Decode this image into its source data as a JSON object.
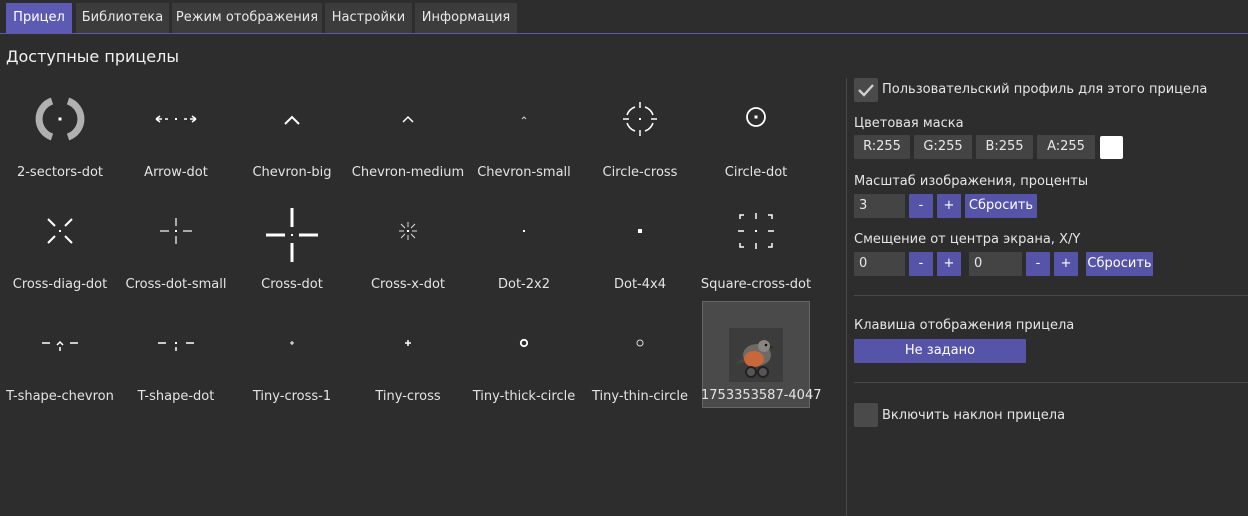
{
  "tabs": [
    {
      "label": "Прицел",
      "active": true
    },
    {
      "label": "Библиотека",
      "active": false
    },
    {
      "label": "Режим отображения",
      "active": false
    },
    {
      "label": "Настройки",
      "active": false
    },
    {
      "label": "Информация",
      "active": false
    }
  ],
  "page_title": "Доступные прицелы",
  "crosshairs": [
    {
      "name": "2-sectors-dot",
      "icon": "two-sectors-dot-icon"
    },
    {
      "name": "Arrow-dot",
      "icon": "arrow-dot-icon"
    },
    {
      "name": "Chevron-big",
      "icon": "chevron-big-icon"
    },
    {
      "name": "Chevron-medium",
      "icon": "chevron-medium-icon"
    },
    {
      "name": "Chevron-small",
      "icon": "chevron-small-icon"
    },
    {
      "name": "Circle-cross",
      "icon": "circle-cross-icon"
    },
    {
      "name": "Circle-dot",
      "icon": "circle-dot-icon"
    },
    {
      "name": "Cross-diag-dot",
      "icon": "cross-diag-dot-icon"
    },
    {
      "name": "Cross-dot-small",
      "icon": "cross-dot-small-icon"
    },
    {
      "name": "Cross-dot",
      "icon": "cross-dot-icon"
    },
    {
      "name": "Cross-x-dot",
      "icon": "cross-x-dot-icon"
    },
    {
      "name": "Dot-2x2",
      "icon": "dot-2x2-icon"
    },
    {
      "name": "Dot-4x4",
      "icon": "dot-4x4-icon"
    },
    {
      "name": "Square-cross-dot",
      "icon": "square-cross-dot-icon"
    },
    {
      "name": "T-shape-chevron",
      "icon": "t-shape-chevron-icon"
    },
    {
      "name": "T-shape-dot",
      "icon": "t-shape-dot-icon"
    },
    {
      "name": "Tiny-cross-1",
      "icon": "tiny-cross-1-icon"
    },
    {
      "name": "Tiny-cross",
      "icon": "tiny-cross-icon"
    },
    {
      "name": "Tiny-thick-circle",
      "icon": "tiny-thick-circle-icon"
    },
    {
      "name": "Tiny-thin-circle",
      "icon": "tiny-thin-circle-icon"
    },
    {
      "name": "1753353587-4047",
      "icon": "bird-image-icon",
      "selected": true
    }
  ],
  "panel": {
    "custom_profile": {
      "label": "Пользовательский профиль для этого прицела",
      "checked": true
    },
    "color_mask": {
      "label": "Цветовая маска",
      "r": "R:255",
      "g": "G:255",
      "b": "B:255",
      "a": "A:255",
      "swatch_color": "#ffffff"
    },
    "scale": {
      "label": "Масштаб изображения, проценты",
      "value": "3",
      "minus": "-",
      "plus": "+",
      "reset": "Сбросить"
    },
    "offset": {
      "label": "Смещение от центра экрана, X/Y",
      "x": "0",
      "y": "0",
      "minus": "-",
      "plus": "+",
      "reset": "Сбросить"
    },
    "hotkey": {
      "label": "Клавиша отображения прицела",
      "value": "Не задано"
    },
    "tilt": {
      "label": "Включить наклон прицела",
      "checked": false
    }
  },
  "colors": {
    "accent": "#5c5ab2",
    "background": "#2d2d2d",
    "chip": "#444444"
  }
}
